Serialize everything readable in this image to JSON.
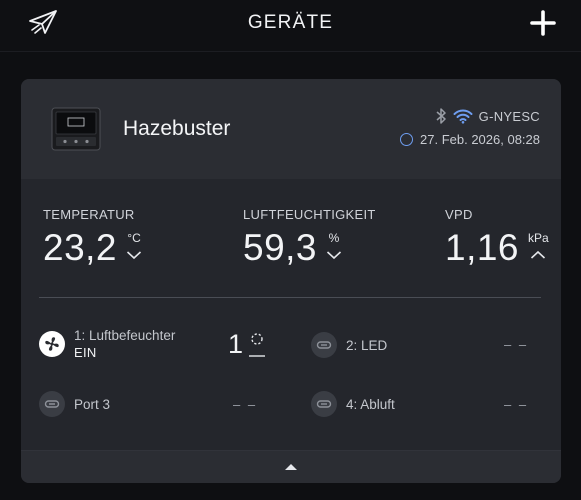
{
  "header": {
    "title": "GERÄTE",
    "logo_icon": "paper-plane-logo-icon",
    "add_icon": "plus-icon"
  },
  "device": {
    "name": "Hazebuster",
    "image_icon": "controller-device-icon",
    "connection": {
      "bluetooth_icon": "bluetooth-icon",
      "wifi_icon": "wifi-icon",
      "id": "G-NYESC"
    },
    "timestamp": "27. Feb. 2026, 08:28",
    "status_icon": "status-ring-icon"
  },
  "readings": [
    {
      "label": "TEMPERATUR",
      "value": "23,2",
      "unit": "°C",
      "trend": "down"
    },
    {
      "label": "LUFTFEUCHTIGKEIT",
      "value": "59,3",
      "unit": "%",
      "trend": "down"
    },
    {
      "label": "VPD",
      "value": "1,16",
      "unit": "kPa",
      "trend": "up"
    }
  ],
  "ports": [
    {
      "name": "1: Luftbefeuchter",
      "state": "EIN",
      "value": "1",
      "icon": "fan-icon",
      "value_icon": "speed-level-icon"
    },
    {
      "name": "2: LED",
      "value": "– –",
      "icon": "plug-icon"
    },
    {
      "name": "Port 3",
      "value": "– –",
      "icon": "plug-icon"
    },
    {
      "name": "4: Abluft",
      "value": "– –",
      "icon": "plug-icon"
    }
  ],
  "footer": {
    "collapse_icon": "chevron-up-icon"
  },
  "colors": {
    "background": "#0e0f12",
    "card": "#24262c",
    "card_header": "#2b2d33",
    "accent": "#6e9df0"
  }
}
